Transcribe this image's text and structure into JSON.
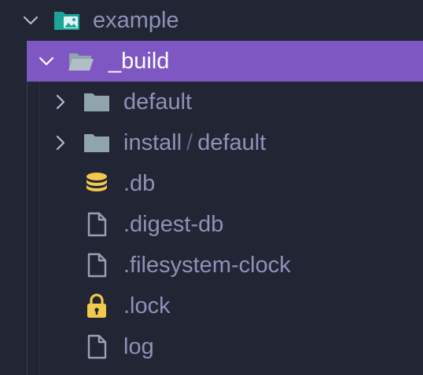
{
  "colors": {
    "background": "#222533",
    "selection": "#7e57c2",
    "label": "#8e92b8",
    "selected_label": "#ffffff",
    "folder_special": "#1aa697",
    "folder": "#90a4ae",
    "db_icon": "#f2c94c",
    "lock_icon": "#f2c94c",
    "file_icon": "#9aa0b8"
  },
  "tree": {
    "root": {
      "label": "example",
      "expanded": true,
      "icon": "folder-images-icon"
    },
    "selected": {
      "label": "_build",
      "expanded": true,
      "icon": "folder-open-icon"
    },
    "items": [
      {
        "label": "default",
        "kind": "folder",
        "icon": "folder-icon"
      },
      {
        "label": "install",
        "label_suffix": "default",
        "separator": "/",
        "kind": "folder",
        "icon": "folder-icon"
      },
      {
        "label": ".db",
        "kind": "file",
        "icon": "database-icon"
      },
      {
        "label": ".digest-db",
        "kind": "file",
        "icon": "file-icon"
      },
      {
        "label": ".filesystem-clock",
        "kind": "file",
        "icon": "file-icon"
      },
      {
        "label": ".lock",
        "kind": "file",
        "icon": "lock-icon"
      },
      {
        "label": "log",
        "kind": "file",
        "icon": "file-icon"
      }
    ]
  }
}
